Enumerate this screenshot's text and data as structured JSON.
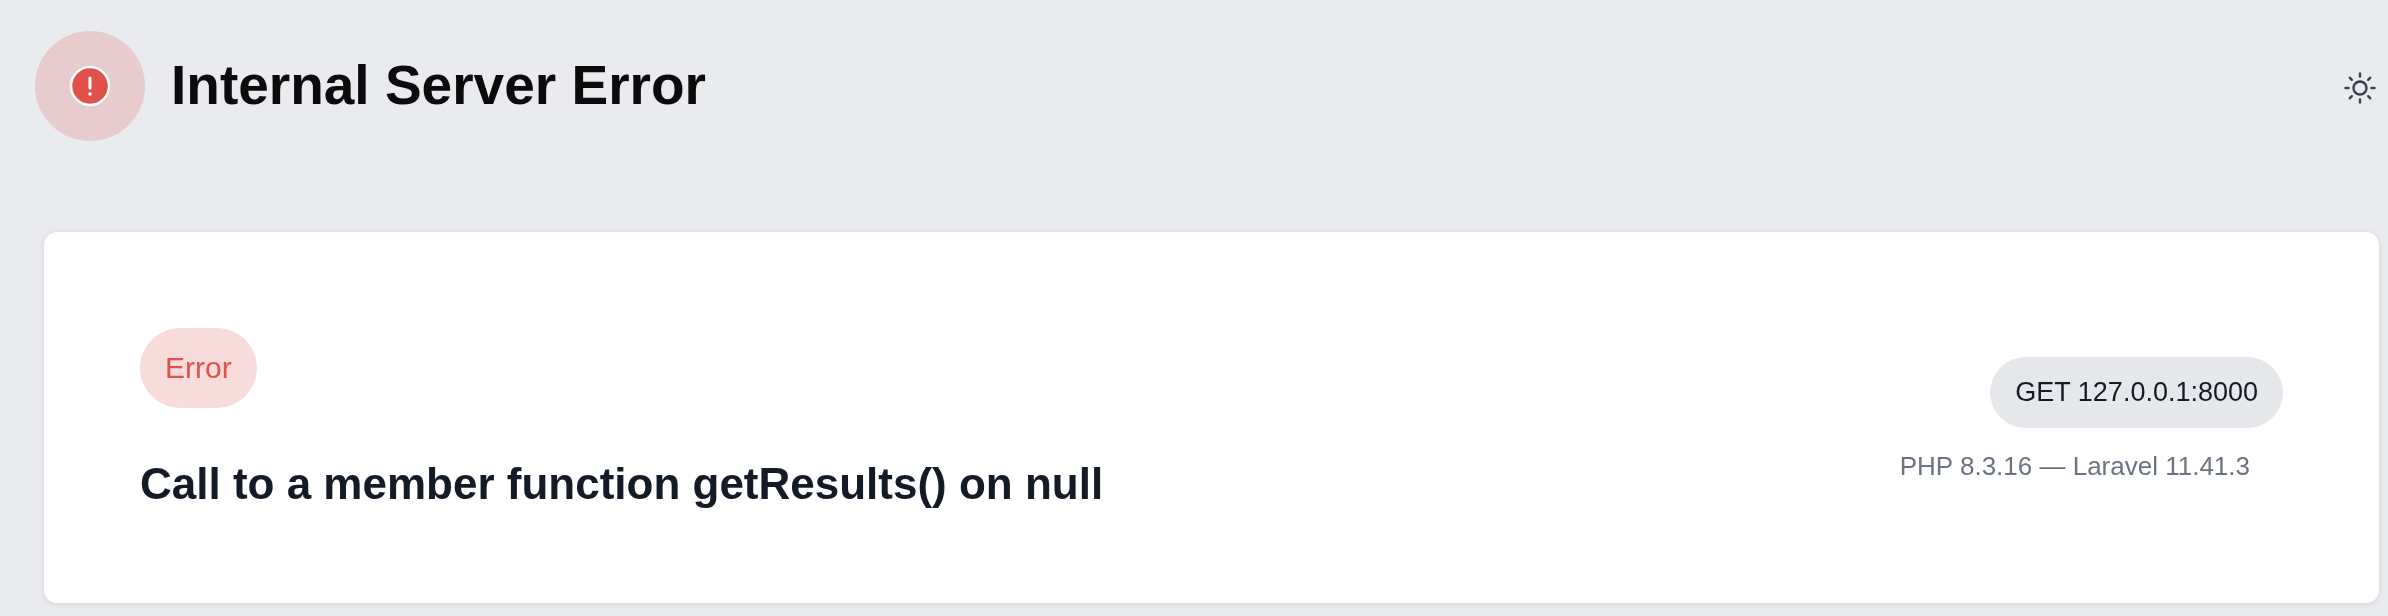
{
  "header": {
    "title": "Internal Server Error"
  },
  "exception": {
    "type_badge": "Error",
    "message": "Call to a member function getResults() on null"
  },
  "request": {
    "method_url": "GET 127.0.0.1:8000",
    "versions": "PHP 8.3.16 — Laravel 11.41.3"
  }
}
